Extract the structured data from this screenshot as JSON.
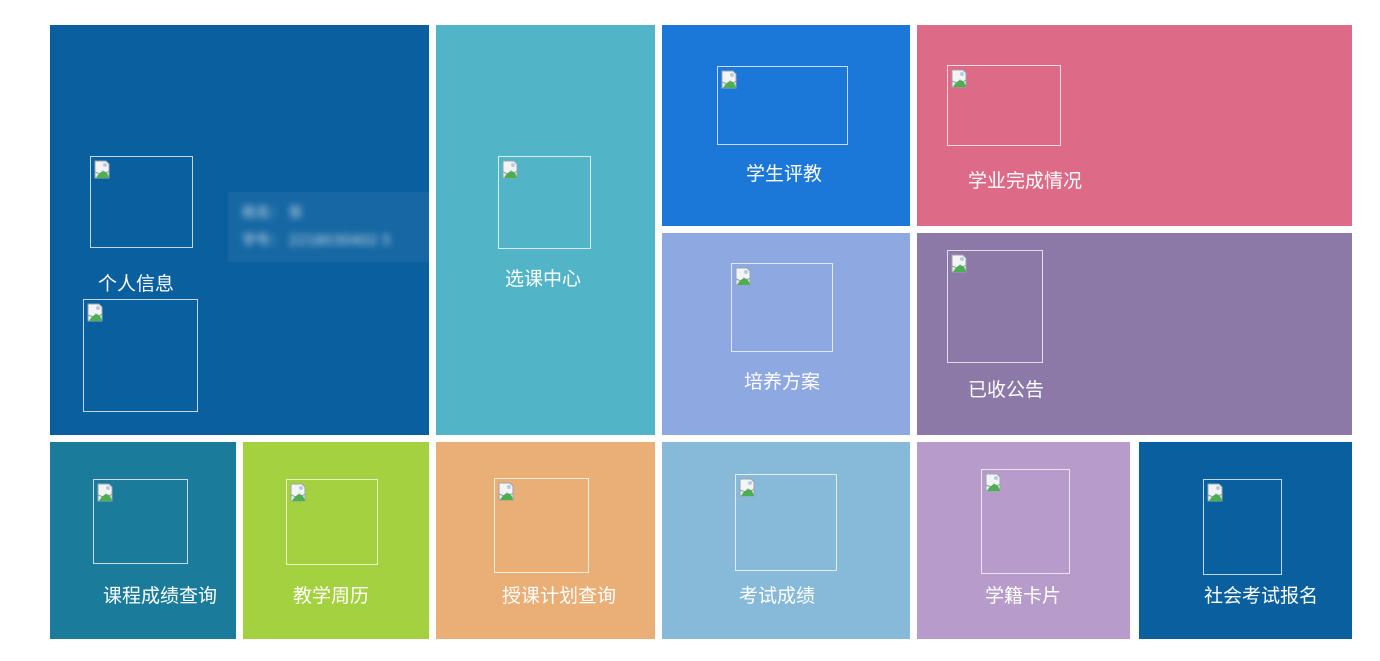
{
  "tiles": {
    "personal_info": "个人信息",
    "course_selection": "选课中心",
    "student_evaluation": "学生评教",
    "academic_completion": "学业完成情况",
    "training_plan": "培养方案",
    "received_notices": "已收公告",
    "course_grades": "课程成绩查询",
    "teaching_calendar": "教学周历",
    "teaching_plan_query": "授课计划查询",
    "exam_scores": "考试成绩",
    "student_card": "学籍卡片",
    "social_exam_registration": "社会考试报名"
  },
  "profile": {
    "name_line": "姓名：     张",
    "id_line": "学号：  2218030402 5"
  },
  "colors": {
    "personal_info": "#0a5f9f",
    "course_selection": "#51b4c7",
    "student_evaluation": "#1c78d8",
    "academic_completion": "#dd6a86",
    "training_plan": "#8ea8e2",
    "received_notices": "#8c79a8",
    "course_grades": "#1a7b9a",
    "teaching_calendar": "#a4d13f",
    "teaching_plan_query": "#eaaf76",
    "exam_scores": "#87b9d8",
    "student_card": "#b79ccb",
    "social_exam_registration": "#0a5f9f"
  },
  "icons": {
    "personal_info_icon": "broken-image-icon",
    "id_card_icon": "broken-image-icon",
    "generic": "broken-image-icon"
  }
}
